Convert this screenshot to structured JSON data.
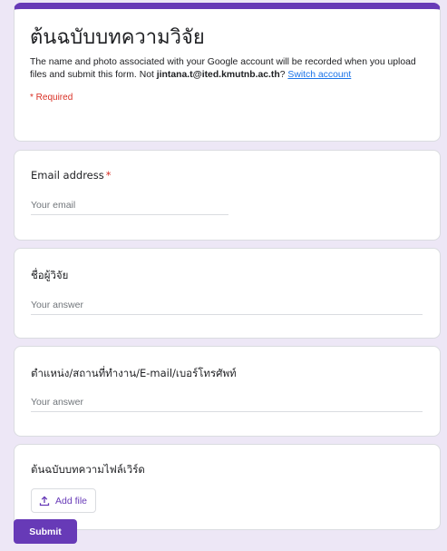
{
  "form": {
    "title": "ต้นฉบับบทความวิจัย",
    "description": {
      "line1": "The name and photo associated with your Google account will be recorded when you upload",
      "line2_prefix": "files and submit this form. Not ",
      "account_email": "jintana.t@ited.kmutnb.ac.th",
      "line2_suffix": "? ",
      "switch_account_label": "Switch account"
    },
    "required_note": "* Required"
  },
  "questions": {
    "email": {
      "label": "Email address",
      "required_marker": "*",
      "placeholder": "Your email",
      "value": ""
    },
    "researcher_name": {
      "label": "ชื่อผู้วิจัย",
      "placeholder": "Your answer",
      "value": ""
    },
    "position_contact": {
      "label": "ตำแหน่ง/สถานที่ทำงาน/E-mail/เบอร์โทรศัพท์",
      "placeholder": "Your answer",
      "value": ""
    },
    "manuscript_file": {
      "label": "ต้นฉบับบทความไฟล์เวิร์ด",
      "add_file_label": "Add file",
      "icon": "upload-icon"
    }
  },
  "actions": {
    "submit_label": "Submit"
  },
  "colors": {
    "accent": "#673ab7",
    "background": "#ede7f6",
    "required": "#d93025",
    "link": "#1a73e8"
  }
}
